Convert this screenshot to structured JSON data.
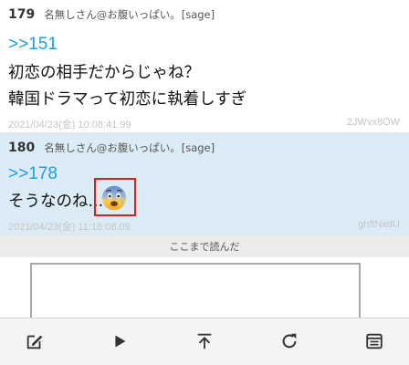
{
  "posts": [
    {
      "number": "179",
      "author": "名無しさん@お腹いっぱい。",
      "mail": "[sage]",
      "reply_to": ">>151",
      "lines": [
        "初恋の相手だからじゃね？",
        "韓国ドラマって初恋に執着しすぎ"
      ],
      "date": "2021/04/23(金) 10:08:41.99",
      "id": "2JWvx8OW"
    },
    {
      "number": "180",
      "author": "名無しさん@お腹いっぱい。",
      "mail": "[sage]",
      "reply_to": ">>178",
      "lines": [
        "そうなのね..."
      ],
      "emoji": "fearful-face-emoji",
      "date": "2021/04/23(金) 11:18:08.09",
      "id": "ghftNxdU",
      "highlighted": true
    }
  ],
  "read_marker": "ここまで読んだ",
  "toolbar": {
    "icons": [
      "compose-icon",
      "play-icon",
      "scroll-top-icon",
      "reload-icon",
      "menu-icon"
    ]
  },
  "colors": {
    "link": "#1a9fe0",
    "highlight_bg": "#dcecf7",
    "annotation_box": "#e21b1b",
    "meta_text": "#c4c4c4"
  }
}
